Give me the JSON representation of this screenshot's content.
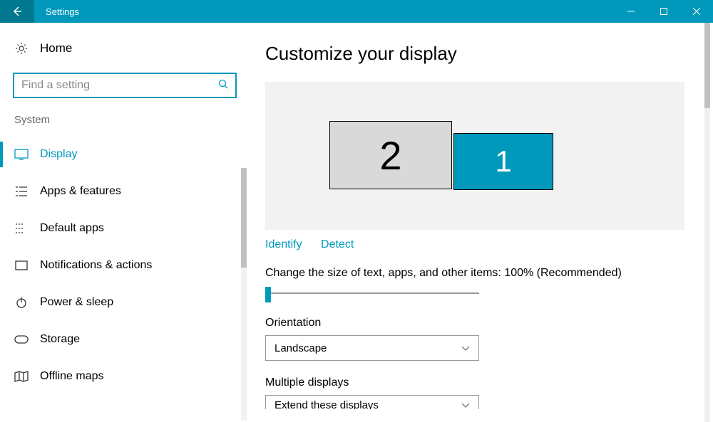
{
  "window": {
    "title": "Settings"
  },
  "sidebar": {
    "home_label": "Home",
    "search_placeholder": "Find a setting",
    "section": "System",
    "items": [
      {
        "label": "Display",
        "active": true
      },
      {
        "label": "Apps & features"
      },
      {
        "label": "Default apps"
      },
      {
        "label": "Notifications & actions"
      },
      {
        "label": "Power & sleep"
      },
      {
        "label": "Storage"
      },
      {
        "label": "Offline maps"
      }
    ]
  },
  "content": {
    "title": "Customize your display",
    "monitors": {
      "primary": "1",
      "secondary": "2"
    },
    "links": {
      "identify": "Identify",
      "detect": "Detect"
    },
    "scale_text": "Change the size of text, apps, and other items: 100% (Recommended)",
    "orientation_label": "Orientation",
    "orientation_value": "Landscape",
    "multiple_label": "Multiple displays",
    "multiple_value": "Extend these displays"
  }
}
